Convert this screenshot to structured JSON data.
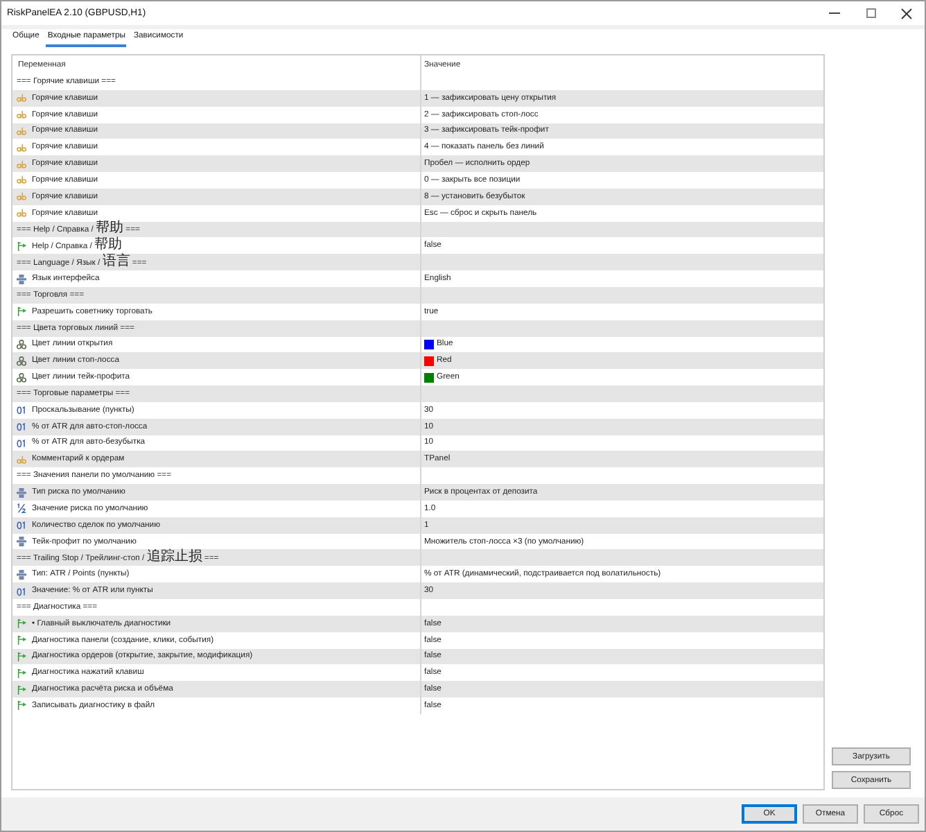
{
  "window": {
    "title": "RiskPanelEA 2.10 (GBPUSD,H1)"
  },
  "tabs": [
    {
      "label": "Общие",
      "selected": false
    },
    {
      "label": "Входные параметры",
      "selected": true
    },
    {
      "label": "Зависимости",
      "selected": false
    }
  ],
  "table": {
    "columns": [
      "Переменная",
      "Значение"
    ],
    "rows": [
      {
        "kind": "group",
        "label": "=== Горячие клавиши ==="
      },
      {
        "kind": "string",
        "name": "Горячие клавиши",
        "value": "1 — зафиксировать цену открытия"
      },
      {
        "kind": "string",
        "name": "Горячие клавиши",
        "value": "2 — зафиксировать стоп-лосс"
      },
      {
        "kind": "string",
        "name": "Горячие клавиши",
        "value": "3 — зафиксировать тейк-профит"
      },
      {
        "kind": "string",
        "name": "Горячие клавиши",
        "value": "4 — показать панель без линий"
      },
      {
        "kind": "string",
        "name": "Горячие клавиши",
        "value": "Пробел — исполнить ордер"
      },
      {
        "kind": "string",
        "name": "Горячие клавиши",
        "value": "0 — закрыть все позиции"
      },
      {
        "kind": "string",
        "name": "Горячие клавиши",
        "value": "8 — установить безубыток"
      },
      {
        "kind": "string",
        "name": "Горячие клавиши",
        "value": "Esc — сброс и скрыть панель"
      },
      {
        "kind": "group",
        "label": "=== Help / Справка / 帮助 ==="
      },
      {
        "kind": "bool",
        "name": "Help / Справка / 帮助",
        "value": "false"
      },
      {
        "kind": "group",
        "label": "=== Language / Язык / 语言 ==="
      },
      {
        "kind": "enum",
        "name": "Язык интерфейса",
        "value": "English"
      },
      {
        "kind": "group",
        "label": "=== Торговля ==="
      },
      {
        "kind": "bool",
        "name": "Разрешить советнику торговать",
        "value": "true"
      },
      {
        "kind": "group",
        "label": "=== Цвета торговых линий ==="
      },
      {
        "kind": "color",
        "name": "Цвет линии открытия",
        "value": "Blue",
        "color": "#0000ff"
      },
      {
        "kind": "color",
        "name": "Цвет линии стоп-лосса",
        "value": "Red",
        "color": "#ff0000"
      },
      {
        "kind": "color",
        "name": "Цвет линии тейк-профита",
        "value": "Green",
        "color": "#008000"
      },
      {
        "kind": "group",
        "label": "=== Торговые параметры ==="
      },
      {
        "kind": "int",
        "name": "Проскальзывание (пункты)",
        "value": "30"
      },
      {
        "kind": "int",
        "name": "% от ATR для авто-стоп-лосса",
        "value": "10"
      },
      {
        "kind": "int",
        "name": "% от ATR для авто-безубытка",
        "value": "10"
      },
      {
        "kind": "string",
        "name": "Комментарий к ордерам",
        "value": "TPanel"
      },
      {
        "kind": "group",
        "label": "=== Значения панели по умолчанию ==="
      },
      {
        "kind": "enum",
        "name": "Тип риска по умолчанию",
        "value": "Риск в процентах от депозита"
      },
      {
        "kind": "double",
        "name": "Значение риска по умолчанию",
        "value": "1.0"
      },
      {
        "kind": "int",
        "name": "Количество сделок по умолчанию",
        "value": "1"
      },
      {
        "kind": "enum",
        "name": "Тейк-профит по умолчанию",
        "value": "Множитель стоп-лосса ×3 (по умолчанию)"
      },
      {
        "kind": "group",
        "label": "=== Trailing Stop / Трейлинг-стоп / 追踪止损 ==="
      },
      {
        "kind": "enum",
        "name": "Тип: ATR / Points (пункты)",
        "value": "% от ATR (динамический, подстраивается под волатильность)"
      },
      {
        "kind": "int",
        "name": "Значение: % от ATR или пункты",
        "value": "30"
      },
      {
        "kind": "group",
        "label": "=== Диагностика ==="
      },
      {
        "kind": "bool",
        "name": "• Главный выключатель диагностики",
        "value": "false"
      },
      {
        "kind": "bool",
        "name": "Диагностика панели (создание, клики, события)",
        "value": "false"
      },
      {
        "kind": "bool",
        "name": "Диагностика ордеров (открытие, закрытие, модификация)",
        "value": "false"
      },
      {
        "kind": "bool",
        "name": "Диагностика нажатий клавиш",
        "value": "false"
      },
      {
        "kind": "bool",
        "name": "Диагностика расчёта риска и объёма",
        "value": "false"
      },
      {
        "kind": "bool",
        "name": "Записывать диагностику в файл",
        "value": "false"
      }
    ]
  },
  "side_buttons": [
    "Загрузить",
    "Сохранить"
  ],
  "buttons": [
    {
      "label": "OK",
      "default": true
    },
    {
      "label": "Отмена",
      "default": false
    },
    {
      "label": "Сброс",
      "default": false
    }
  ]
}
